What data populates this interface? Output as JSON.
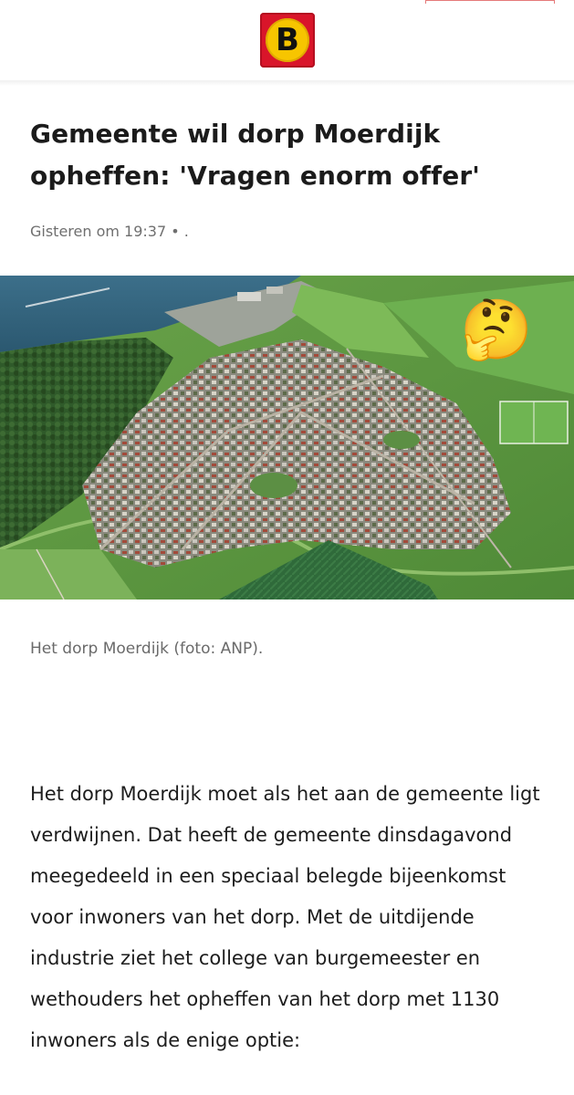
{
  "header": {
    "logo_letter": "B",
    "logo_icon": "bd-logo-icon"
  },
  "article": {
    "title": "Gemeente wil dorp Moerdijk opheffen: 'Vragen enorm offer'",
    "meta": "Gisteren om 19:37 • .",
    "photo": {
      "overlay_emoji": "🤔",
      "overlay_icon": "thinking-face-emoji-icon"
    },
    "caption": "Het dorp Moerdijk (foto: ANP).",
    "body": "Het dorp Moerdijk moet als het aan de gemeente ligt verdwijnen. Dat heeft de gemeente dinsdagavond meegedeeld in een speciaal belegde bijeenkomst voor inwoners van het dorp. Met de uitdijende industrie ziet het college van burgemeester en wethouders het opheffen van het dorp met 1130 inwoners als de enige optie:"
  },
  "colors": {
    "logo_red": "#d9152a",
    "logo_yellow": "#f7c500",
    "water": "#2f5f7a",
    "meta_gray": "#6f6f6f"
  }
}
